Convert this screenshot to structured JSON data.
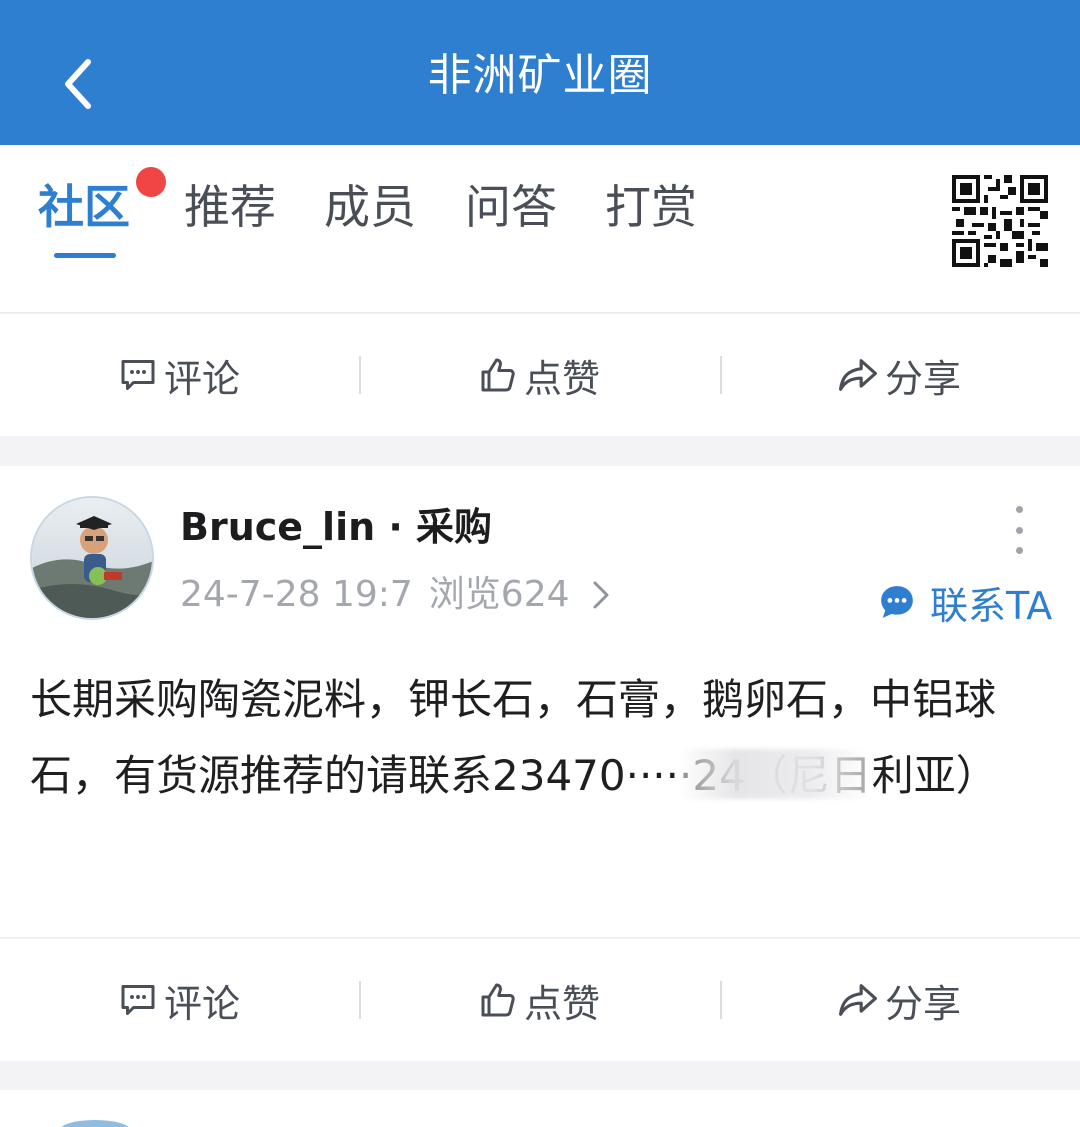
{
  "header": {
    "title": "非洲矿业圈"
  },
  "tabs": [
    {
      "label": "社区",
      "active": true,
      "has_dot": true
    },
    {
      "label": "推荐",
      "active": false
    },
    {
      "label": "成员",
      "active": false
    },
    {
      "label": "问答",
      "active": false
    },
    {
      "label": "打赏",
      "active": false
    }
  ],
  "actions_top": {
    "comment": "评论",
    "like": "点赞",
    "share": "分享"
  },
  "post": {
    "author": "Bruce_lin · 采购",
    "date": "24-7-28 19:7",
    "views": "浏览624",
    "contact_label": "联系TA",
    "body": "长期采购陶瓷泥料，钾长石，石膏，鹅卵石，中铝球石，有货源推荐的请联系23470·····24（尼日利亚）"
  },
  "actions_bottom": {
    "comment": "评论",
    "like": "点赞",
    "share": "分享"
  },
  "colors": {
    "brand": "#2f7fd0",
    "badge": "#f04545",
    "muted": "#a4a8ae"
  }
}
